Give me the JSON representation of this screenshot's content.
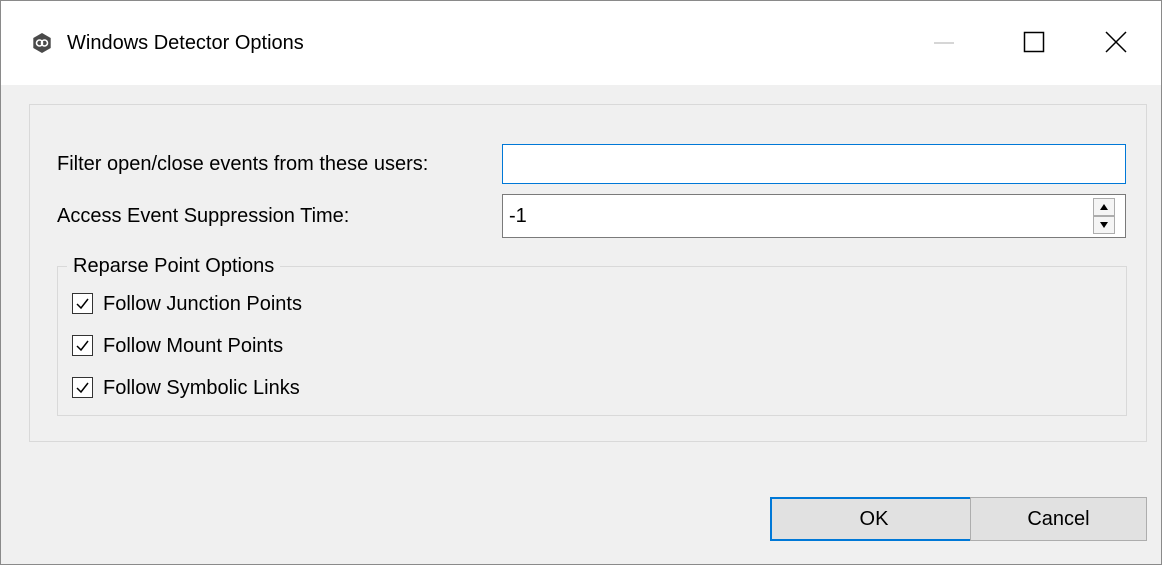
{
  "window": {
    "title": "Windows Detector Options",
    "icon": "app-logo-icon",
    "controls": [
      "minimize-icon",
      "maximize-icon",
      "close-icon"
    ]
  },
  "form": {
    "filter_label": "Filter open/close events from these users:",
    "filter_value": "",
    "suppression_label": "Access Event Suppression Time:",
    "suppression_value": "-1"
  },
  "reparse": {
    "legend": "Reparse Point Options",
    "options": [
      {
        "label": "Follow Junction Points",
        "checked": true
      },
      {
        "label": "Follow Mount Points",
        "checked": true
      },
      {
        "label": "Follow Symbolic Links",
        "checked": true
      }
    ]
  },
  "buttons": {
    "ok": "OK",
    "cancel": "Cancel"
  },
  "colors": {
    "focus_border": "#0078d7",
    "dialog_bg": "#f0f0f0"
  }
}
